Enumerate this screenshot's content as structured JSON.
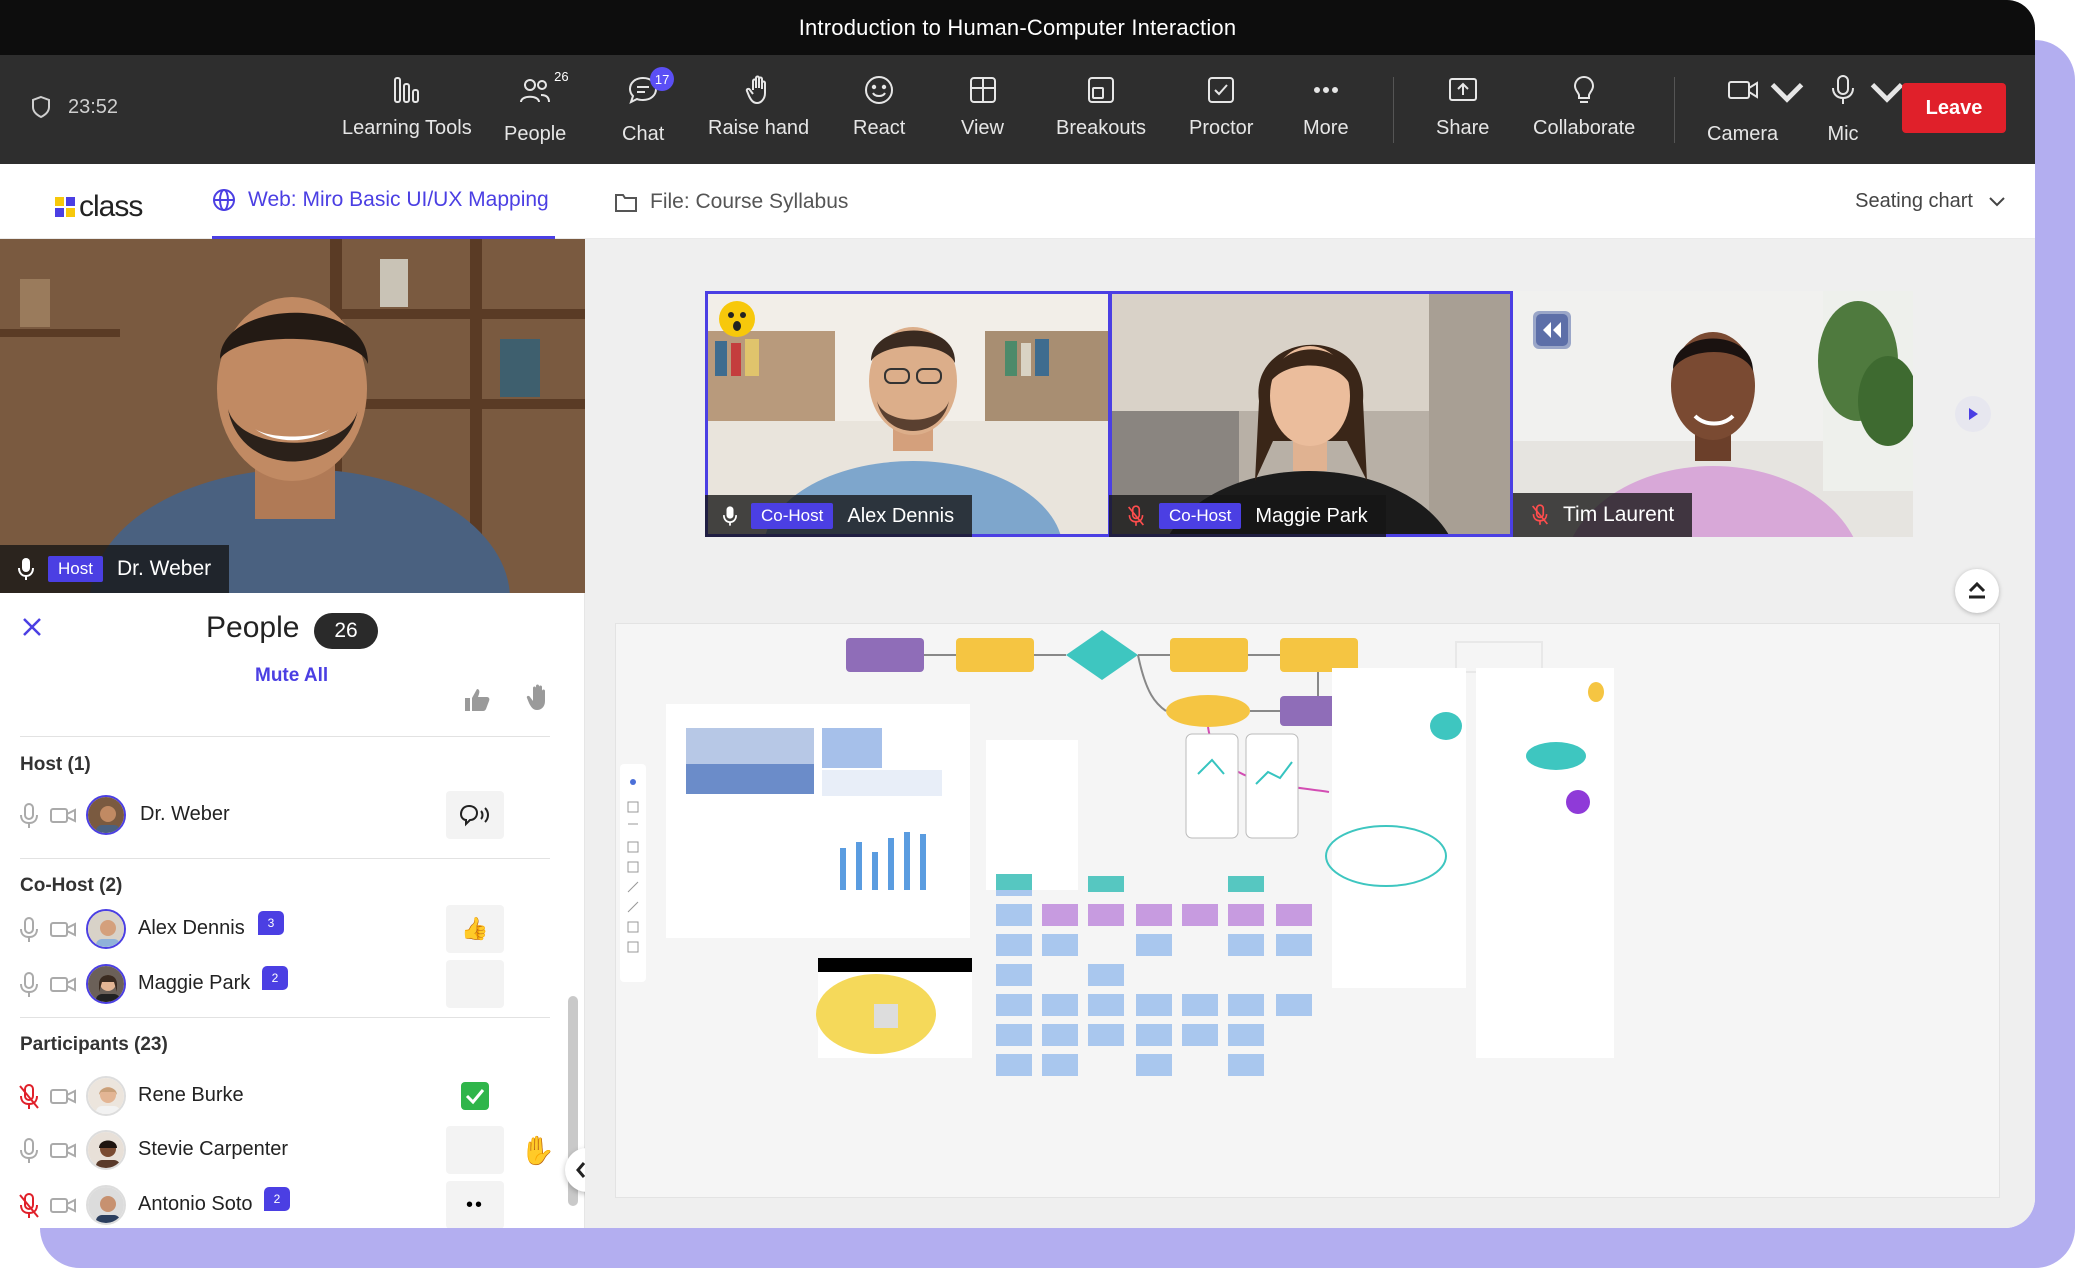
{
  "window": {
    "title": "Introduction to Human-Computer Interaction"
  },
  "toolbar": {
    "timer": "23:52",
    "items": [
      {
        "label": "Learning Tools",
        "icon": "bar-chart-icon"
      },
      {
        "label": "People",
        "icon": "people-icon",
        "count": "26"
      },
      {
        "label": "Chat",
        "icon": "chat-icon",
        "badge": "17"
      },
      {
        "label": "Raise hand",
        "icon": "hand-icon"
      },
      {
        "label": "React",
        "icon": "smile-icon"
      },
      {
        "label": "View",
        "icon": "view-icon"
      },
      {
        "label": "Breakouts",
        "icon": "breakouts-icon"
      },
      {
        "label": "Proctor",
        "icon": "proctor-icon"
      },
      {
        "label": "More",
        "icon": "more-icon"
      },
      {
        "label": "Share",
        "icon": "share-icon"
      },
      {
        "label": "Collaborate",
        "icon": "lightbulb-icon"
      },
      {
        "label": "Camera",
        "icon": "camera-icon"
      },
      {
        "label": "Mic",
        "icon": "mic-icon"
      }
    ],
    "leave": "Leave"
  },
  "tabs": {
    "logo": "class",
    "web_tab": "Web: Miro Basic UI/UX Mapping",
    "file_tab": "File: Course Syllabus",
    "seating": "Seating chart"
  },
  "host_video": {
    "role": "Host",
    "name": "Dr. Weber"
  },
  "videos": [
    {
      "role": "Co-Host",
      "name": "Alex Dennis"
    },
    {
      "role": "Co-Host",
      "name": "Maggie Park"
    },
    {
      "role": "",
      "name": "Tim Laurent"
    }
  ],
  "people": {
    "title": "People",
    "count": "26",
    "mute_all": "Mute All",
    "host_header": "Host (1)",
    "cohost_header": "Co-Host (2)",
    "participants_header": "Participants (23)",
    "host": [
      {
        "name": "Dr. Weber"
      }
    ],
    "cohosts": [
      {
        "name": "Alex Dennis",
        "chat": "3"
      },
      {
        "name": "Maggie Park",
        "chat": "2"
      }
    ],
    "participants": [
      {
        "name": "Rene Burke"
      },
      {
        "name": "Stevie Carpenter"
      },
      {
        "name": "Antonio Soto",
        "chat": "2"
      }
    ]
  },
  "colors": {
    "accent": "#4b3fe3",
    "leave": "#e0202a",
    "toolbar": "#2e2e2e",
    "titlebar": "#0d0d0d"
  }
}
